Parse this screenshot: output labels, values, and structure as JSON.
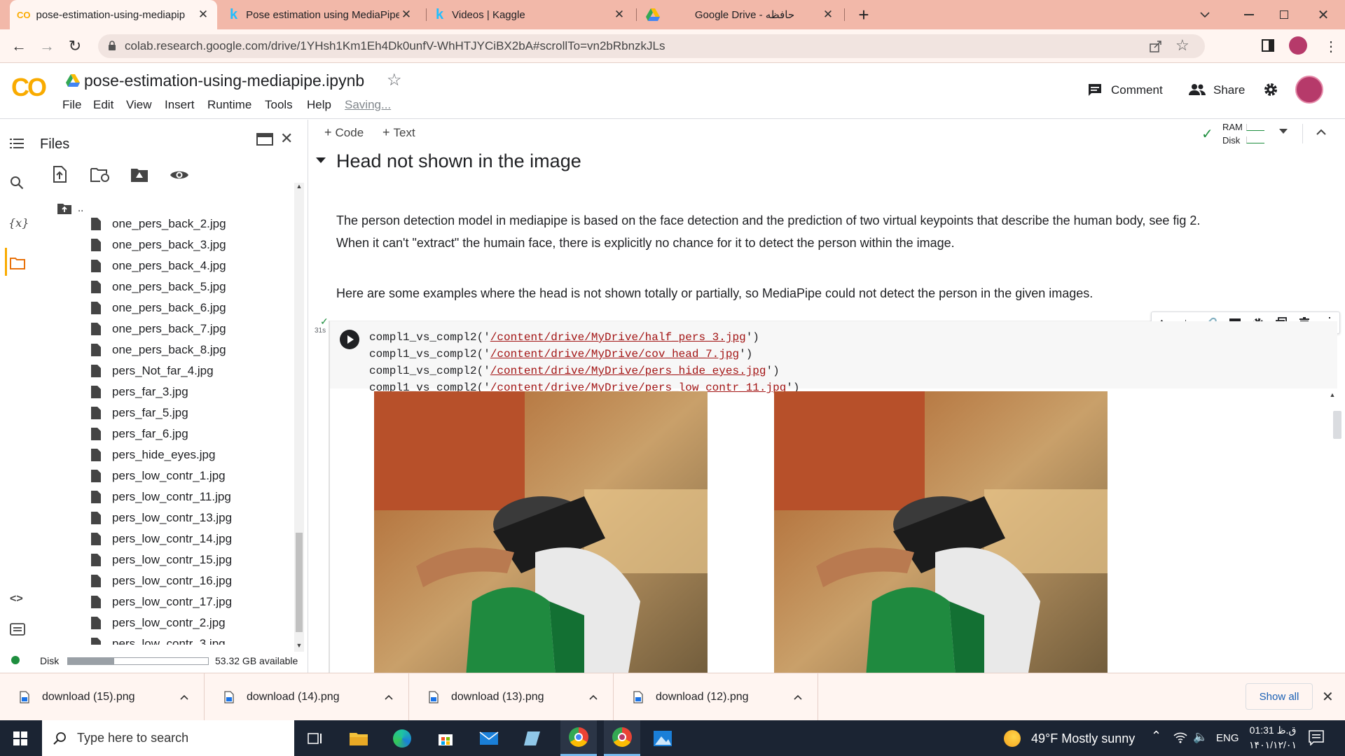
{
  "browser": {
    "tabs": [
      {
        "title": "pose-estimation-using-mediapip",
        "icon": "colab-icon"
      },
      {
        "title": "Pose estimation using MediaPipe",
        "icon": "kaggle-icon"
      },
      {
        "title": "Videos | Kaggle",
        "icon": "kaggle-icon"
      },
      {
        "title": "Google Drive - حافظه",
        "icon": "drive-icon"
      }
    ],
    "url": "colab.research.google.com/drive/1YHsh1Km1Eh4Dk0unfV-WhHTJYCiBX2bA#scrollTo=vn2bRbnzkJLs"
  },
  "colab": {
    "logo": "CO",
    "notebook_title": "pose-estimation-using-mediapipe.ipynb",
    "menu": [
      "File",
      "Edit",
      "View",
      "Insert",
      "Runtime",
      "Tools",
      "Help"
    ],
    "saving": "Saving...",
    "comment_label": "Comment",
    "share_label": "Share"
  },
  "files": {
    "title": "Files",
    "parent": "..",
    "partial_item": "one_pers_back_2.jpg",
    "items": [
      "one_pers_back_3.jpg",
      "one_pers_back_4.jpg",
      "one_pers_back_5.jpg",
      "one_pers_back_6.jpg",
      "one_pers_back_7.jpg",
      "one_pers_back_8.jpg",
      "pers_Not_far_4.jpg",
      "pers_far_3.jpg",
      "pers_far_5.jpg",
      "pers_far_6.jpg",
      "pers_hide_eyes.jpg",
      "pers_low_contr_1.jpg",
      "pers_low_contr_11.jpg",
      "pers_low_contr_13.jpg",
      "pers_low_contr_14.jpg",
      "pers_low_contr_15.jpg",
      "pers_low_contr_16.jpg",
      "pers_low_contr_17.jpg",
      "pers_low_contr_2.jpg",
      "pers_low_contr_3.jpg"
    ],
    "disk_label": "Disk",
    "disk_available": "53.32 GB available",
    "disk_used_fraction": 0.33
  },
  "toolbar": {
    "code_label": "Code",
    "text_label": "Text",
    "ram_label": "RAM",
    "disk_label": "Disk"
  },
  "notebook": {
    "heading": "Head not shown in the image",
    "para1": "The person detection model in mediapipe is based on the face detection and the prediction of two virtual keypoints that describe the human body, see fig 2. When it can't \"extract\" the humain face, there is explicitly no chance for it to detect the person within the image.",
    "para2": "Here are some examples where the head is not shown totally or partially, so MediaPipe could not detect the person in the given images.",
    "exec_time": "31s",
    "code_func": "compl1_vs_compl2",
    "code_paths": [
      "/content/drive/MyDrive/half_pers_3.jpg",
      "/content/drive/MyDrive/cov_head_7.jpg",
      "/content/drive/MyDrive/pers_hide_eyes.jpg",
      "/content/drive/MyDrive/pers_low_contr_11.jpg"
    ]
  },
  "downloads": {
    "items": [
      "download (15).png",
      "download (14).png",
      "download (13).png",
      "download (12).png"
    ],
    "show_all": "Show all"
  },
  "taskbar": {
    "search_placeholder": "Type here to search",
    "weather": "49°F  Mostly sunny",
    "language": "ENG",
    "time": "01:31 ق.ظ",
    "date": "۱۴۰۱/۱۲/۰۱"
  },
  "colors": {
    "tab_strip": "#f2b8a9",
    "colab_orange": "#f9ab00",
    "string_red": "#a31515",
    "taskbar": "#1b2433"
  }
}
